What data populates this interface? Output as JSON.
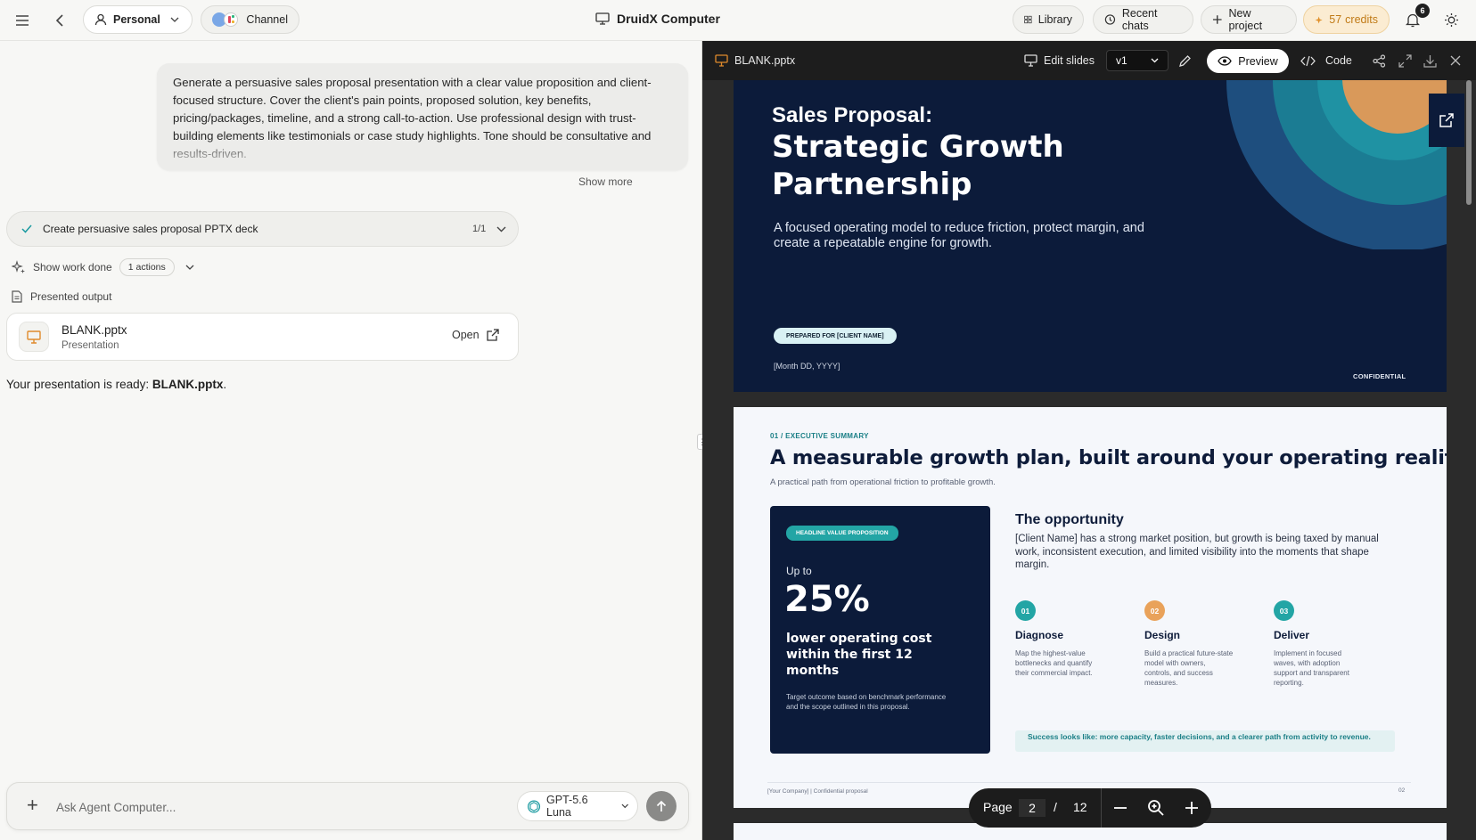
{
  "topbar": {
    "workspace": "Personal",
    "channel": "Channel",
    "app_title": "DruidX Computer",
    "library": "Library",
    "recent_chats": "Recent chats",
    "new_project": "New project",
    "credits_value": "57",
    "credits_label": "credits",
    "notifications_count": "6",
    "accent_credits": "#c07a16"
  },
  "chat": {
    "user_message": "Generate a persuasive sales proposal presentation with a clear value proposition and client-focused structure. Cover the client's pain points, proposed solution, key benefits, pricing/packages, timeline, and a strong call-to-action. Use professional design with trust-building elements like testimonials or case study highlights. Tone should be consultative and results-driven.",
    "show_more": "Show more",
    "task_label": "Create persuasive sales proposal PPTX deck",
    "task_count": "1/1",
    "work_done_label": "Show work done",
    "actions_badge": "1 actions",
    "presented_output": "Presented output",
    "file_name": "BLANK.pptx",
    "file_type": "Presentation",
    "open_label": "Open",
    "ready_prefix": "Your presentation is ready: ",
    "ready_file": "BLANK.pptx",
    "ready_suffix": "."
  },
  "composer": {
    "placeholder": "Ask Agent Computer...",
    "model": "GPT-5.6 Luna"
  },
  "viewer": {
    "file_name": "BLANK.pptx",
    "edit_slides": "Edit slides",
    "version": "v1",
    "preview": "Preview",
    "code": "Code"
  },
  "slide1": {
    "pretitle": "Sales Proposal:",
    "title": "Strategic Growth Partnership",
    "subtitle": "A focused operating model to reduce friction, protect margin, and create a repeatable engine for growth.",
    "prepared_for": "PREPARED FOR [CLIENT NAME]",
    "date": "[Month DD, YYYY]",
    "confidential": "CONFIDENTIAL"
  },
  "slide2": {
    "kicker": "01 / EXECUTIVE SUMMARY",
    "title": "A measurable growth plan, built around your operating reality.",
    "subtitle": "A practical path from operational friction to profitable growth.",
    "card_chip": "HEADLINE VALUE PROPOSITION",
    "card_upto": "Up to",
    "card_big": "25%",
    "card_desc": "lower operating cost within the first 12 months",
    "card_note": "Target outcome based on benchmark performance and the scope outlined in this proposal.",
    "opportunity_heading": "The opportunity",
    "opportunity_text": "[Client Name] has a strong market position, but growth is being taxed by manual work, inconsistent execution, and limited visibility into the moments that shape margin.",
    "steps": [
      {
        "num": "01",
        "name": "Diagnose",
        "text": "Map the highest-value bottlenecks and quantify their commercial impact.",
        "color": "#23a5a5"
      },
      {
        "num": "02",
        "name": "Design",
        "text": "Build a practical future-state model with owners, controls, and success measures.",
        "color": "#e9a25a"
      },
      {
        "num": "03",
        "name": "Deliver",
        "text": "Implement in focused waves, with adoption support and transparent reporting.",
        "color": "#23a5a5"
      }
    ],
    "success": "Success looks like: more capacity, faster decisions, and a clearer path from activity to revenue.",
    "footer": "[Your Company]  |  Confidential proposal",
    "page_num": "02"
  },
  "pager": {
    "label": "Page",
    "current": "2",
    "slash": "/",
    "total": "12"
  }
}
